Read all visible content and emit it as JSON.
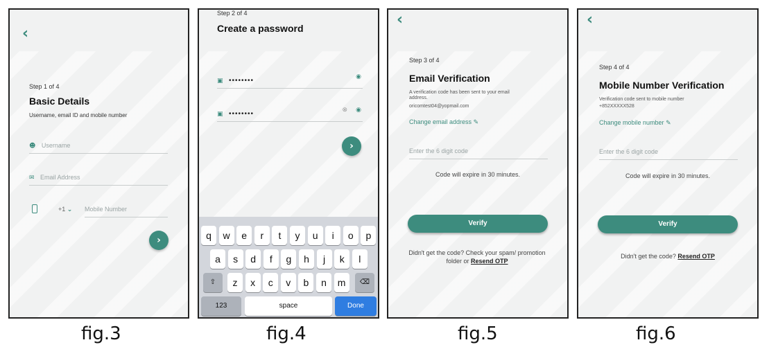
{
  "fig3": {
    "step": "Step 1 of 4",
    "title": "Basic Details",
    "subtitle": "Username, email ID and mobile number",
    "username_ph": "Username",
    "email_ph": "Email Address",
    "country_code": "+1",
    "mobile_ph": "Mobile Number",
    "caption": "fig.3"
  },
  "fig4": {
    "step": "Step 2 of 4",
    "title": "Create a password",
    "password1": "••••••••",
    "password2": "••••••••",
    "keyboard": {
      "row1": [
        "q",
        "w",
        "e",
        "r",
        "t",
        "y",
        "u",
        "i",
        "o",
        "p"
      ],
      "row2": [
        "a",
        "s",
        "d",
        "f",
        "g",
        "h",
        "j",
        "k",
        "l"
      ],
      "row3": [
        "z",
        "x",
        "c",
        "v",
        "b",
        "n",
        "m"
      ],
      "num": "123",
      "space": "space",
      "done": "Done"
    },
    "caption": "fig.4"
  },
  "fig5": {
    "step": "Step 3 of 4",
    "title": "Email Verification",
    "info": "A verification code has been sent to your email address.",
    "email": "oricomtest04@yopmail.com",
    "change_link": "Change email address",
    "code_ph": "Enter the 6 digit code",
    "expire": "Code will expire in 30 minutes.",
    "verify": "Verify",
    "resend_pre": "Didn't get the code? Check your spam/ promotion folder or",
    "resend": "Resend OTP",
    "caption": "fig.5"
  },
  "fig6": {
    "step": "Step 4 of 4",
    "title": "Mobile Number Verification",
    "info": "Verification code sent to mobile number",
    "number": "+852XXXXX528",
    "change_link": "Change mobile number",
    "code_ph": "Enter the 6 digit code",
    "expire": "Code will expire in 30 minutes.",
    "verify": "Verify",
    "resend_pre": "Didn't get the code?",
    "resend": "Resend OTP",
    "caption": "fig.6"
  },
  "icons": {
    "back": "chevron-left-icon",
    "user": "user-icon",
    "mail": "mail-icon",
    "phone": "phone-icon",
    "lock": "lock-icon",
    "eye": "eye-icon",
    "clear": "clear-icon",
    "edit": "pencil-icon",
    "next": "arrow-right-icon",
    "shift": "shift-icon",
    "backspace": "backspace-icon"
  },
  "colors": {
    "accent": "#3d8c7e",
    "done": "#2f7de1"
  }
}
